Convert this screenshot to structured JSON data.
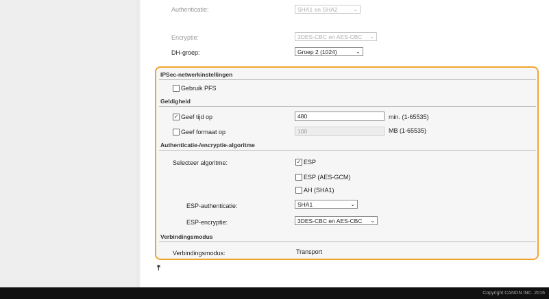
{
  "top_settings": {
    "auth_label": "Authenticatie:",
    "auth_value": "SHA1 en SHA2",
    "enc_label": "Encryptie:",
    "enc_value": "3DES-CBC en AES-CBC",
    "dh_label": "DH-groep:",
    "dh_value": "Groep 2 (1024)"
  },
  "ipsec": {
    "section_title": "IPSec-netwerkinstellingen",
    "pfs_label": "Gebruik PFS",
    "pfs_checked": false
  },
  "validity": {
    "section_title": "Geldigheid",
    "time_label": "Geef tijd op",
    "time_checked": true,
    "time_value": "480",
    "time_unit": "min. (1-65535)",
    "size_label": "Geef formaat op",
    "size_checked": false,
    "size_value": "100",
    "size_unit": "MB (1-65535)"
  },
  "auth_enc_algo": {
    "section_title": "Authenticatie-/encryptie-algoritme",
    "selector_label": "Selecteer algoritme:",
    "options": [
      {
        "label": "ESP",
        "checked": true
      },
      {
        "label": "ESP (AES-GCM)",
        "checked": false
      },
      {
        "label": "AH (SHA1)",
        "checked": false
      }
    ],
    "esp_auth_label": "ESP-authenticatie:",
    "esp_auth_value": "SHA1",
    "esp_enc_label": "ESP-encryptie:",
    "esp_enc_value": "3DES-CBC en AES-CBC"
  },
  "connection": {
    "section_title": "Verbindingsmodus",
    "mode_label": "Verbindingsmodus:",
    "mode_value": "Transport"
  },
  "top_link_glyph": "⤒",
  "footer": {
    "copyright": "Copyright CANON INC. 2016"
  },
  "colors": {
    "panel_border": "#f1a42c",
    "footer_bg": "#111111"
  }
}
